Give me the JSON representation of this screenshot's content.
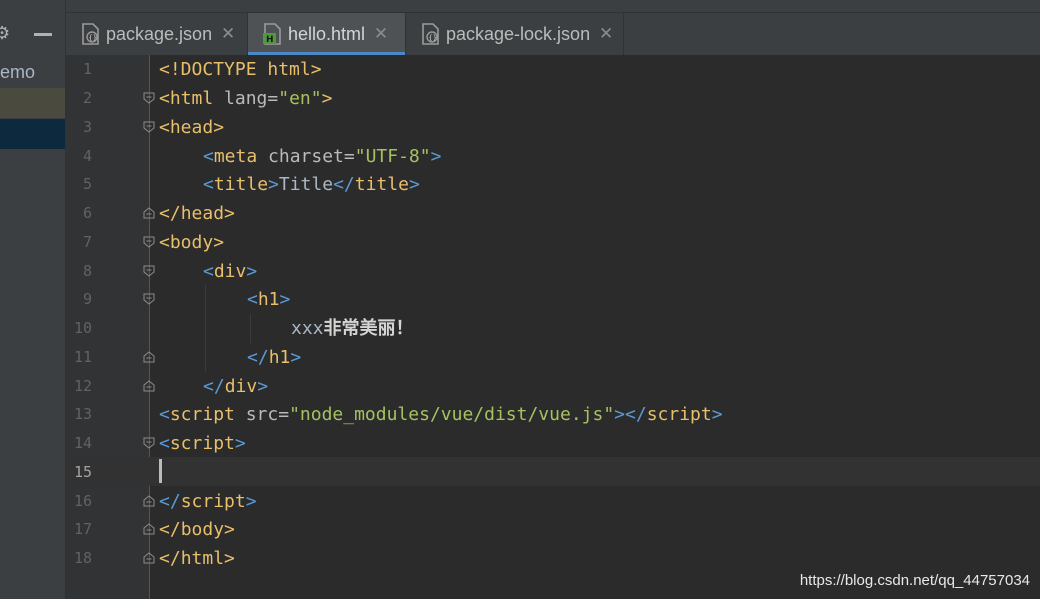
{
  "project_panel": {
    "title_fragment": "emo"
  },
  "tabs": [
    {
      "label": "package.json",
      "icon": "json-file-icon",
      "active": false
    },
    {
      "label": "hello.html",
      "icon": "html-file-icon",
      "active": true
    },
    {
      "label": "package-lock.json",
      "icon": "json-file-icon",
      "active": false
    }
  ],
  "line_numbers": [
    "1",
    "2",
    "3",
    "4",
    "5",
    "6",
    "7",
    "8",
    "9",
    "10",
    "11",
    "12",
    "13",
    "14",
    "15",
    "16",
    "17",
    "18"
  ],
  "current_line": "15",
  "code": {
    "l1": {
      "tag": "<!DOCTYPE html>"
    },
    "l2": {
      "open": "<",
      "tag": "html",
      "attr": " lang=",
      "str": "\"en\"",
      "close": ">"
    },
    "l3": {
      "open": "<",
      "tag": "head",
      "close": ">"
    },
    "l4": {
      "open": "<",
      "tag": "meta",
      "attr": " charset=",
      "str": "\"UTF-8\"",
      "close": ">"
    },
    "l5": {
      "open": "<",
      "tag": "title",
      "close": ">",
      "text": "Title",
      "open2": "</",
      "tag2": "title",
      "close2": ">"
    },
    "l6": {
      "open": "</",
      "tag": "head",
      "close": ">"
    },
    "l7": {
      "open": "<",
      "tag": "body",
      "close": ">"
    },
    "l8": {
      "open": "<",
      "tag": "div",
      "close": ">"
    },
    "l9": {
      "open": "<",
      "tag": "h1",
      "close": ">"
    },
    "l10": {
      "text": "xxx",
      "cjk": "非常美丽！"
    },
    "l11": {
      "open": "</",
      "tag": "h1",
      "close": ">"
    },
    "l12": {
      "open": "</",
      "tag": "div",
      "close": ">"
    },
    "l13": {
      "open": "<",
      "tag": "script",
      "attr": " src=",
      "str": "\"node_modules/vue/dist/vue.js\"",
      "close": ">",
      "open2": "</",
      "tag2": "script",
      "close2": ">"
    },
    "l14": {
      "open": "<",
      "tag": "script",
      "close": ">"
    },
    "l16": {
      "open": "</",
      "tag": "script",
      "close": ">"
    },
    "l17": {
      "open": "</",
      "tag": "body",
      "close": ">"
    },
    "l18": {
      "open": "</",
      "tag": "html",
      "close": ">"
    }
  },
  "watermark": "https://blog.csdn.net/qq_44757034"
}
